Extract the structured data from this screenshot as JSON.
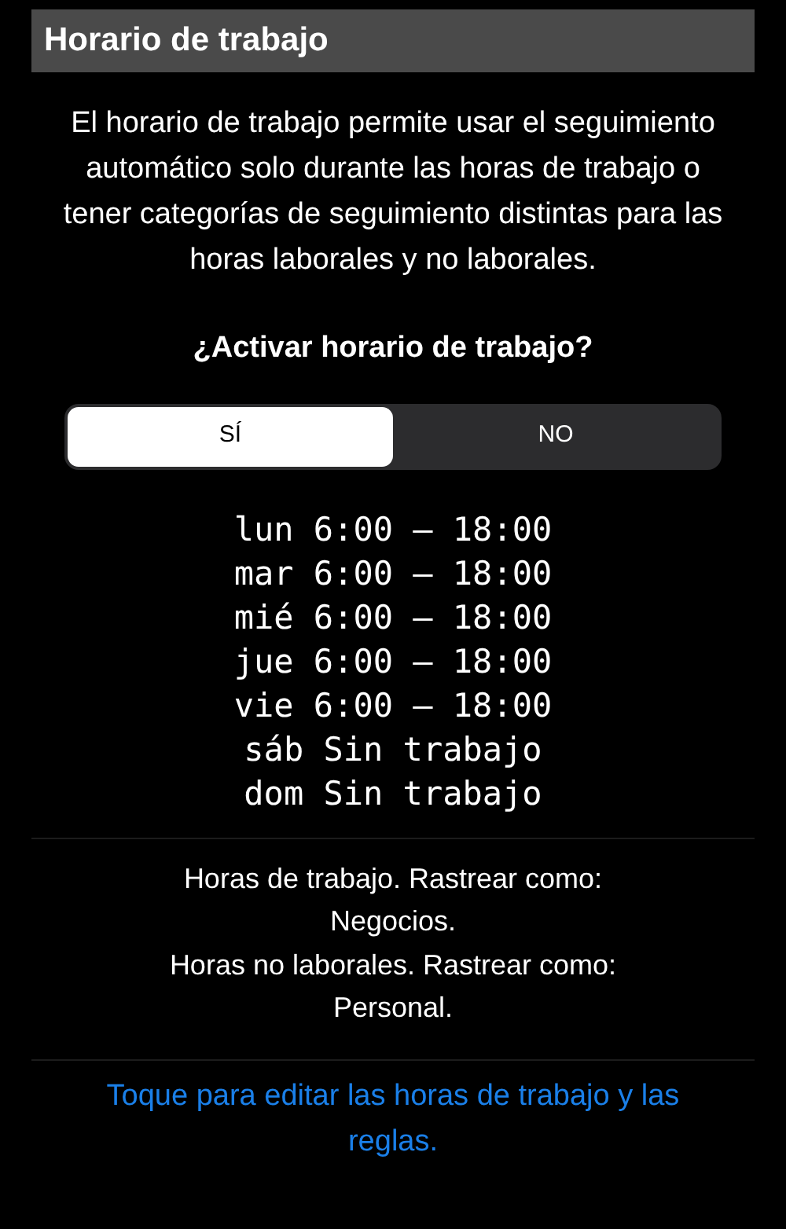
{
  "header": {
    "title": "Horario de trabajo"
  },
  "description": "El horario de trabajo permite usar el seguimiento automático solo durante las horas de trabajo o tener categorías de seguimiento distintas para las horas laborales y no laborales.",
  "question": "¿Activar horario de trabajo?",
  "segments": [
    {
      "label": "SÍ",
      "selected": true
    },
    {
      "label": "NO",
      "selected": false
    }
  ],
  "schedule": [
    "lun 6:00 – 18:00",
    "mar 6:00 – 18:00",
    "mié 6:00 – 18:00",
    "jue 6:00 – 18:00",
    "vie 6:00 – 18:00",
    "sáb Sin trabajo",
    "dom Sin trabajo"
  ],
  "summary": [
    "Horas de trabajo. Rastrear como: Negocios.",
    "Horas no laborales. Rastrear como: Personal."
  ],
  "edit_link": "Toque para editar las horas de trabajo y las reglas."
}
